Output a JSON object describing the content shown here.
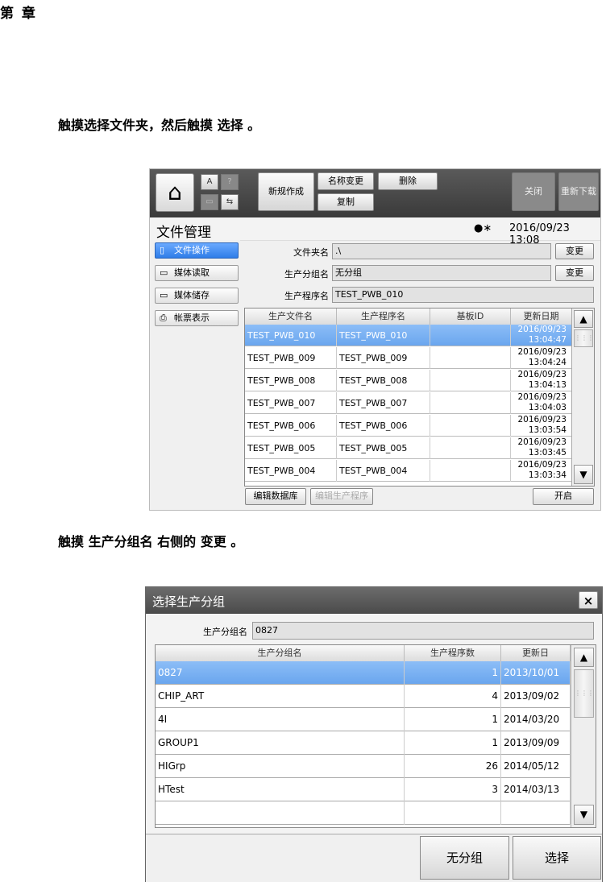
{
  "chapter_header": "第  章",
  "step1_text": "触摸选择文件夹，然后触摸 选择 。",
  "step2_text": "触摸 生产分组名 右侧的 变更 。",
  "screen1": {
    "toolbar": {
      "mini_a": "A",
      "mini_help": "?",
      "mini_3": "▭",
      "mini_4": "⇆",
      "new_create": "新规作成",
      "rename": "名称变更",
      "delete": "删除",
      "copy": "复制",
      "close": "关闭",
      "redownload": "重新下载"
    },
    "title": "文件管理",
    "datetime": "2016/09/23 13:08",
    "nav": [
      "文件操作",
      "媒体读取",
      "媒体储存",
      "帐票表示"
    ],
    "labels": {
      "folder": "文件夹名",
      "group": "生产分组名",
      "program": "生产程序名"
    },
    "values": {
      "folder": ".\\",
      "group": "无分组",
      "program": "TEST_PWB_010"
    },
    "change_label": "变更",
    "table": {
      "headers": [
        "生产文件名",
        "生产程序名",
        "基板ID",
        "更新日期"
      ],
      "rows": [
        [
          "TEST_PWB_010",
          "TEST_PWB_010",
          "",
          "2016/09/23",
          "13:04:47"
        ],
        [
          "TEST_PWB_009",
          "TEST_PWB_009",
          "",
          "2016/09/23",
          "13:04:24"
        ],
        [
          "TEST_PWB_008",
          "TEST_PWB_008",
          "",
          "2016/09/23",
          "13:04:13"
        ],
        [
          "TEST_PWB_007",
          "TEST_PWB_007",
          "",
          "2016/09/23",
          "13:04:03"
        ],
        [
          "TEST_PWB_006",
          "TEST_PWB_006",
          "",
          "2016/09/23",
          "13:03:54"
        ],
        [
          "TEST_PWB_005",
          "TEST_PWB_005",
          "",
          "2016/09/23",
          "13:03:45"
        ],
        [
          "TEST_PWB_004",
          "TEST_PWB_004",
          "",
          "2016/09/23",
          "13:03:34"
        ]
      ]
    },
    "bottom": {
      "edit_db": "编辑数据库",
      "edit_program": "编辑生产程序",
      "open": "开启"
    }
  },
  "screen2": {
    "title": "选择生产分组",
    "close": "×",
    "label_group": "生产分组名",
    "group_value": "0827",
    "table": {
      "headers": [
        "生产分组名",
        "生产程序数",
        "更新日"
      ],
      "rows": [
        [
          "0827",
          "1",
          "2013/10/01"
        ],
        [
          "CHIP_ART",
          "4",
          "2013/09/02"
        ],
        [
          "4I",
          "1",
          "2014/03/20"
        ],
        [
          "GROUP1",
          "1",
          "2013/09/09"
        ],
        [
          "HIGrp",
          "26",
          "2014/05/12"
        ],
        [
          "HTest",
          "3",
          "2014/03/13"
        ],
        [
          "",
          "",
          ""
        ]
      ]
    },
    "btn_nogroup": "无分组",
    "btn_select": "选择"
  }
}
